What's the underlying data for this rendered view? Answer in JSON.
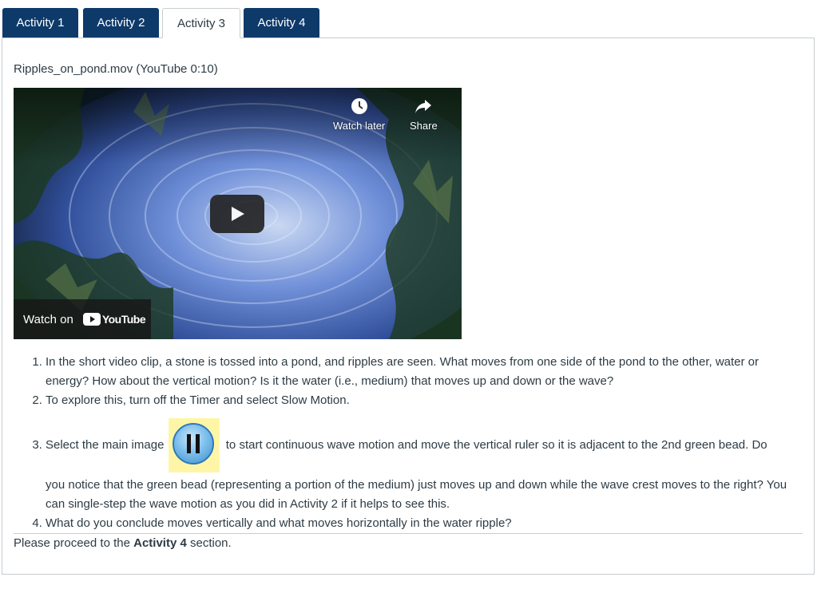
{
  "tabs": [
    {
      "label": "Activity 1",
      "active": false
    },
    {
      "label": "Activity 2",
      "active": false
    },
    {
      "label": "Activity 3",
      "active": true
    },
    {
      "label": "Activity 4",
      "active": false
    }
  ],
  "video": {
    "title": "Ripples_on_pond.mov (YouTube 0:10)",
    "watch_later": "Watch later",
    "share": "Share",
    "watch_on": "Watch on",
    "youtube": "YouTube"
  },
  "steps": {
    "s1": "In the short video clip, a stone is tossed into a pond, and ripples are seen. What moves from one side of the pond to the other, water or energy? How about the vertical motion? Is it the water (i.e., medium) that moves up and down or the wave?",
    "s2": "To explore this, turn off the Timer and select Slow Motion.",
    "s3_before": "Select the main image",
    "s3_after": "to start continuous wave motion and move the vertical ruler so it is adjacent to the 2nd green bead. Do",
    "s3_rest": "you notice that the green bead (representing a portion of the medium) just moves up and down while the wave crest moves to the right? You can single-step the wave motion as you did in Activity 2 if it helps to see this.",
    "s4": "What do you conclude moves vertically and what moves horizontally in the water ripple?"
  },
  "footer": {
    "prefix": "Please proceed to the",
    "link": "Activity 4",
    "suffix": "section."
  },
  "colors": {
    "tab_bg": "#0e3a6a",
    "text": "#2d3b45",
    "border": "#c7cdd1",
    "pause_highlight": "#fef6a6"
  }
}
